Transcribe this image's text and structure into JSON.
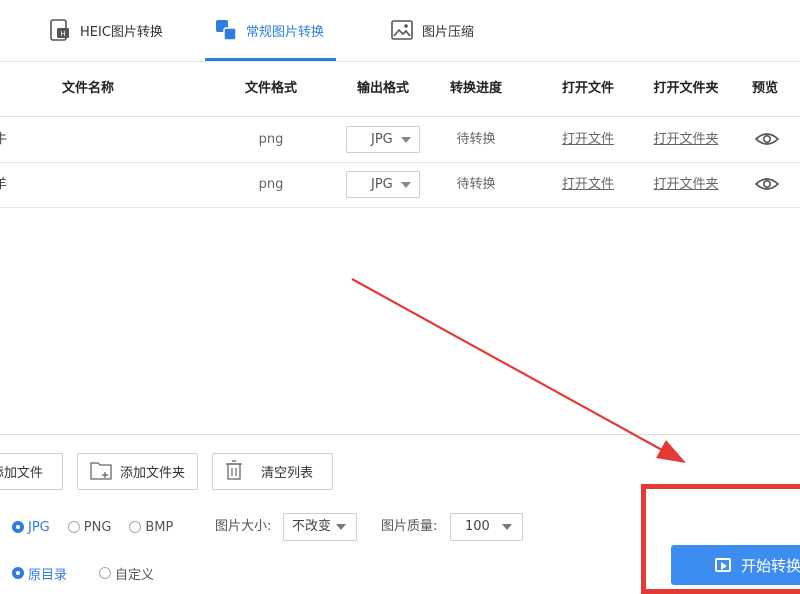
{
  "tabs": [
    {
      "label": "HEIC图片转换",
      "icon": "heic-file-icon",
      "active": false
    },
    {
      "label": "常规图片转换",
      "icon": "convert-images-icon",
      "active": true
    },
    {
      "label": "图片压缩",
      "icon": "image-compress-icon",
      "active": false
    }
  ],
  "table": {
    "headers": [
      "文件名称",
      "文件格式",
      "输出格式",
      "转换进度",
      "打开文件",
      "打开文件夹",
      "预览"
    ],
    "rows": [
      {
        "name": "牛",
        "format": "png",
        "output": "JPG",
        "progress": "待转换",
        "open_file": "打开文件",
        "open_folder": "打开文件夹"
      },
      {
        "name": "羊",
        "format": "png",
        "output": "JPG",
        "progress": "待转换",
        "open_file": "打开文件",
        "open_folder": "打开文件夹"
      }
    ]
  },
  "actions": {
    "add_file": "添加文件",
    "add_folder": "添加文件夹",
    "clear_list": "清空列表"
  },
  "output_format": {
    "options": [
      "JPG",
      "PNG",
      "BMP"
    ],
    "selected": "JPG"
  },
  "image_size": {
    "label": "图片大小:",
    "value": "不改变"
  },
  "image_quality": {
    "label": "图片质量:",
    "value": "100"
  },
  "output_dir": {
    "options": [
      "原目录",
      "自定义"
    ],
    "selected": "原目录"
  },
  "start_button": {
    "label": "开始转换"
  },
  "colors": {
    "accent": "#2f7de1",
    "annotation": "#e53935",
    "button": "#3d8cf0"
  }
}
